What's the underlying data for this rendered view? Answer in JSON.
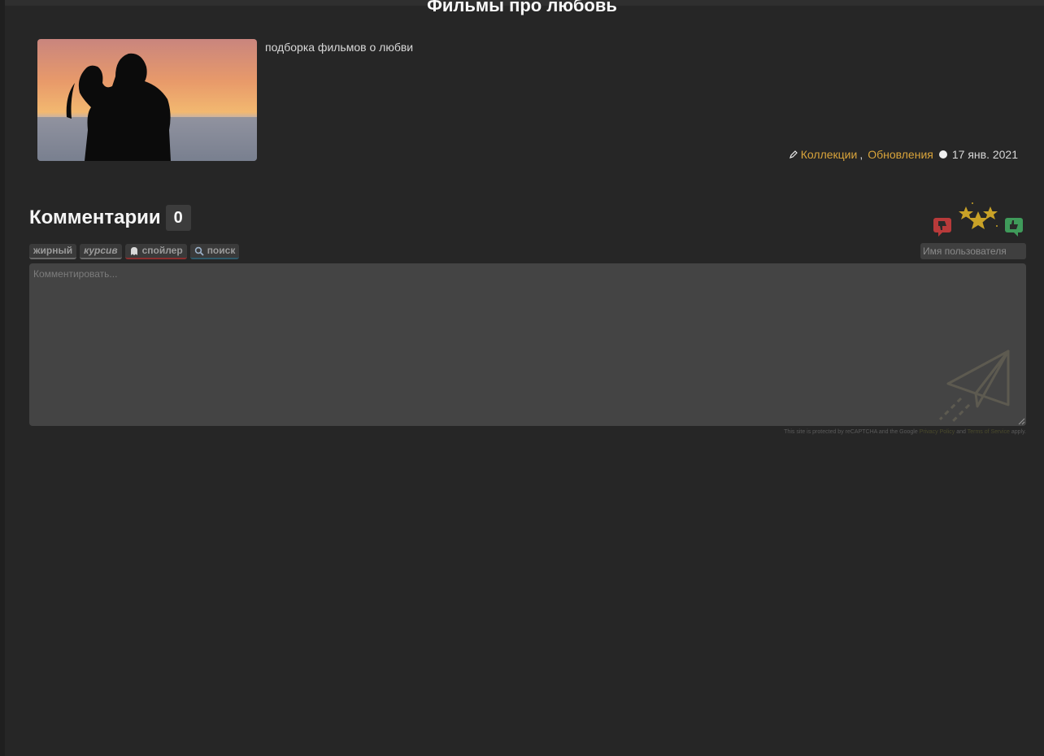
{
  "page": {
    "title": "Фильмы про любовь"
  },
  "article": {
    "description": "подборка фильмов о любви",
    "image_alt": "couple silhouette at sunset",
    "categories": [
      "Коллекции",
      "Обновления"
    ],
    "separator": ",",
    "date": "17 янв. 2021"
  },
  "comments": {
    "title": "Комментарии",
    "count": "0",
    "toolbar": {
      "bold": "жирный",
      "italic": "курсив",
      "spoiler": "спойлер",
      "search": "поиск"
    },
    "username_placeholder": "Имя пользователя",
    "comment_placeholder": "Комментировать...",
    "recaptcha": {
      "prefix": "This site is protected by reCAPTCHA and the Google",
      "privacy": "Privacy Policy",
      "and": "and",
      "terms": "Terms of Service",
      "suffix": "apply."
    }
  },
  "icons": {
    "pencil": "pencil-icon",
    "clock": "clock-icon",
    "dislike": "thumbs-down-icon",
    "stars": "stars-icon",
    "like": "thumbs-up-icon",
    "spoiler": "ghost-icon",
    "search": "magnifier-icon",
    "send": "paper-plane-icon"
  },
  "colors": {
    "background": "#262626",
    "accent_link": "#d9a43b",
    "dislike": "#b83a3a",
    "like": "#3f9a5a",
    "star": "#c9a227"
  }
}
